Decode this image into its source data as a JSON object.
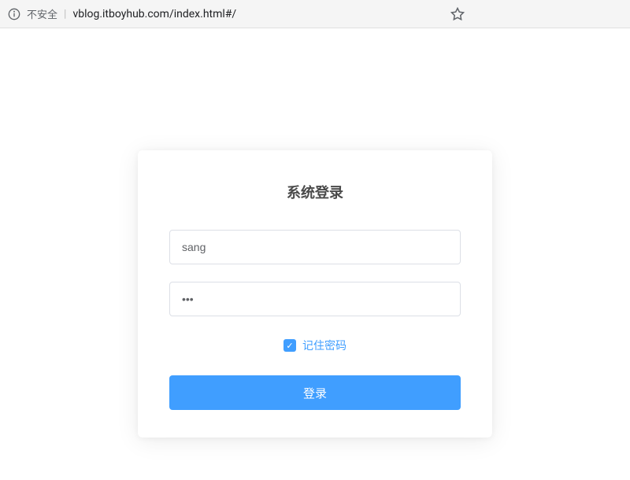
{
  "browser": {
    "security_label": "不安全",
    "url": "vblog.itboyhub.com/index.html#/"
  },
  "login": {
    "title": "系统登录",
    "username_value": "sang",
    "password_value": "•••",
    "remember_label": "记住密码",
    "remember_checked": true,
    "submit_label": "登录"
  }
}
